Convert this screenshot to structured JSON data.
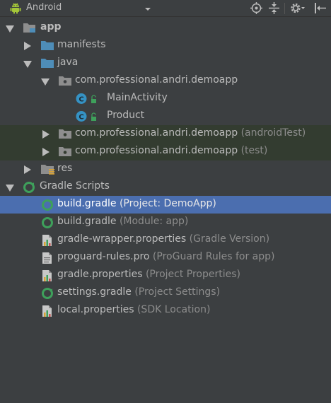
{
  "toolbar": {
    "view_mode": "Android",
    "icons": [
      "android-icon",
      "dropdown-arrow-icon",
      "scroll-from-source-icon",
      "collapse-all-icon",
      "settings-icon",
      "hide-icon"
    ]
  },
  "tree": {
    "app": "app",
    "manifests": "manifests",
    "java": "java",
    "pkg_main": "com.professional.andri.demoapp",
    "class_main_activity": "MainActivity",
    "class_product": "Product",
    "pkg_android_test": "com.professional.andri.demoapp",
    "pkg_android_test_hint": "(androidTest)",
    "pkg_test": "com.professional.andri.demoapp",
    "pkg_test_hint": "(test)",
    "res": "res",
    "gradle_scripts": "Gradle Scripts",
    "files": [
      {
        "name": "build.gradle",
        "hint": "(Project: DemoApp)",
        "icon": "gradle-icon"
      },
      {
        "name": "build.gradle",
        "hint": "(Module: app)",
        "icon": "gradle-icon"
      },
      {
        "name": "gradle-wrapper.properties",
        "hint": "(Gradle Version)",
        "icon": "properties-file-icon"
      },
      {
        "name": "proguard-rules.pro",
        "hint": "(ProGuard Rules for app)",
        "icon": "text-file-icon"
      },
      {
        "name": "gradle.properties",
        "hint": "(Project Properties)",
        "icon": "properties-file-icon"
      },
      {
        "name": "settings.gradle",
        "hint": "(Project Settings)",
        "icon": "gradle-icon"
      },
      {
        "name": "local.properties",
        "hint": "(SDK Location)",
        "icon": "properties-file-icon"
      }
    ]
  },
  "colors": {
    "panel_bg": "#3c3f41",
    "selection": "#4b6eaf",
    "test_band": "#333c30",
    "text": "#bbbbbb",
    "hint_text": "#8c8c8c",
    "gradle_green": "#3ea05b",
    "class_icon": "#3592c4",
    "android_green": "#a4c639",
    "folder_blue": "#4e8db8"
  }
}
